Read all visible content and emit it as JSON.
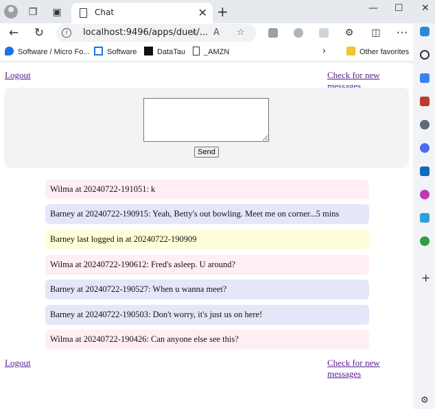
{
  "browser": {
    "tab_title": "Chat",
    "url": "localhost:9496/apps/duet/...",
    "favorites": [
      {
        "label": "Software / Micro Fo..."
      },
      {
        "label": "Software"
      },
      {
        "label": "DataTau"
      },
      {
        "label": "_AMZN"
      }
    ],
    "other_favorites": "Other favorites",
    "colors": {
      "accent": "#0f6cbd",
      "tab_strip": "#e6e9ee"
    }
  },
  "page": {
    "logout_top": "Logout",
    "check_top": "Check for new messages",
    "send_label": "Send",
    "logout_bottom": "Logout",
    "check_bottom": "Check for new messages",
    "messages": [
      {
        "text": "Wilma at 20240722-191051: k",
        "tone": "pink"
      },
      {
        "text": "Barney at 20240722-190915: Yeah, Betty's out bowling. Meet me on corner...5 mins",
        "tone": "lav"
      },
      {
        "text": "Barney last logged in at 20240722-190909",
        "tone": "yel"
      },
      {
        "text": "Wilma at 20240722-190612: Fred's asleep. U around?",
        "tone": "pink"
      },
      {
        "text": "Barney at 20240722-190527: When u wanna meet?",
        "tone": "lav"
      },
      {
        "text": "Barney at 20240722-190503: Don't worry, it's just us on here!",
        "tone": "lav"
      },
      {
        "text": "Wilma at 20240722-190426: Can anyone else see this?",
        "tone": "pink"
      }
    ]
  }
}
